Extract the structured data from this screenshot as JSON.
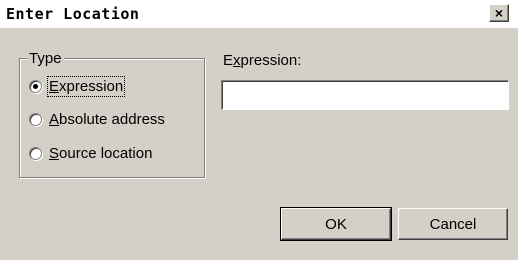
{
  "window": {
    "title": "Enter Location",
    "close_glyph": "×"
  },
  "type_group": {
    "legend": "Type",
    "options": [
      {
        "mnemonic": "E",
        "rest": "xpression",
        "checked": true
      },
      {
        "mnemonic": "A",
        "rest": "bsolute address",
        "checked": false
      },
      {
        "mnemonic": "S",
        "rest": "ource location",
        "checked": false
      }
    ]
  },
  "expression": {
    "label_pre": "E",
    "label_mnemonic": "x",
    "label_post": "pression:",
    "value": ""
  },
  "buttons": {
    "ok": "OK",
    "cancel": "Cancel"
  },
  "colors": {
    "dialog_bg": "#d4d0c8",
    "titlebar_bg": "#ffffff"
  }
}
